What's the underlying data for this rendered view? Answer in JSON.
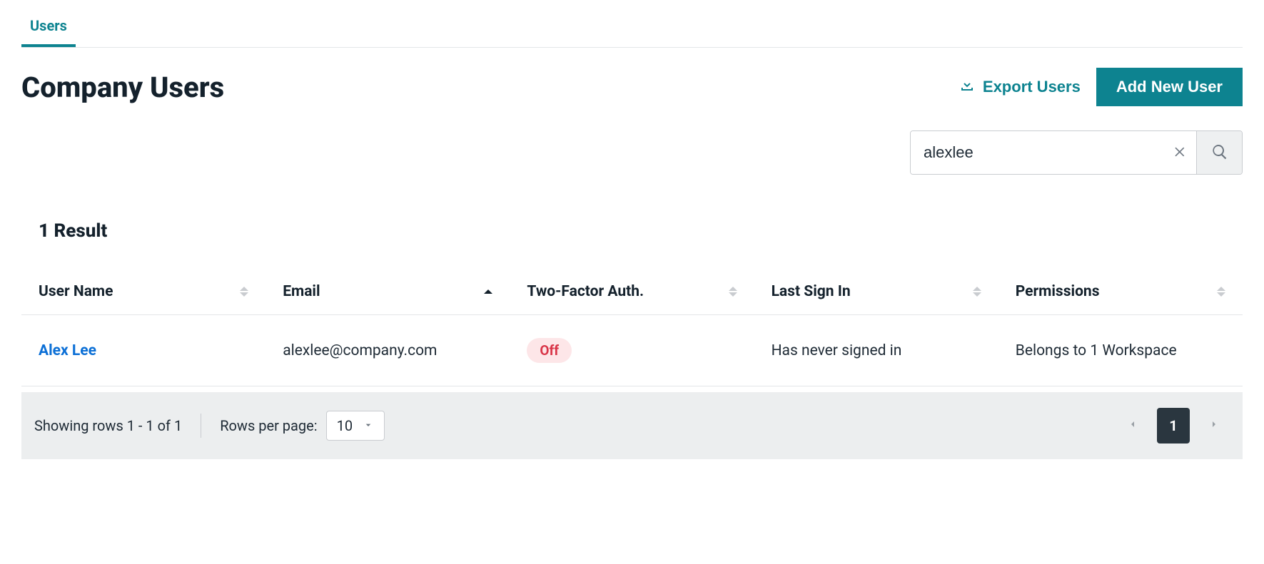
{
  "tabs": [
    {
      "label": "Users",
      "active": true
    }
  ],
  "page": {
    "title": "Company Users",
    "export_label": "Export Users",
    "add_label": "Add New User"
  },
  "search": {
    "value": "alexlee"
  },
  "results": {
    "count_label": "1 Result"
  },
  "table": {
    "columns": {
      "username": "User Name",
      "email": "Email",
      "twofa": "Two-Factor Auth.",
      "lastsignin": "Last Sign In",
      "permissions": "Permissions"
    },
    "rows": [
      {
        "username": "Alex Lee",
        "email": "alexlee@company.com",
        "twofa": "Off",
        "lastsignin": "Has never signed in",
        "permissions": "Belongs to 1 Workspace"
      }
    ]
  },
  "footer": {
    "showing": "Showing rows 1 - 1 of 1",
    "rows_per_page_label": "Rows per page:",
    "rows_per_page_value": "10",
    "current_page": "1"
  }
}
